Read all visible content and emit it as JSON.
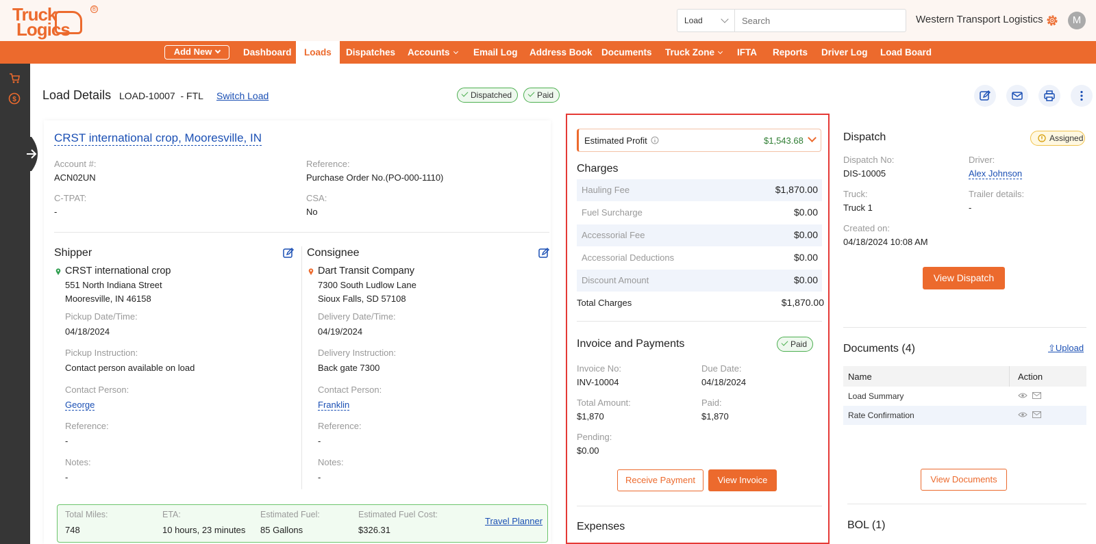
{
  "brand": {
    "logo_line1": "Truck",
    "logo_line2": "Logics",
    "accent": "#ec6a2d"
  },
  "header": {
    "search_scope": "Load",
    "search_placeholder": "Search",
    "company": "Western Transport Logistics",
    "avatar_initial": "M"
  },
  "nav": {
    "add_new": "Add New",
    "items": [
      "Dashboard",
      "Loads",
      "Dispatches",
      "Accounts",
      "Email Log",
      "Address Book",
      "Documents",
      "Truck Zone",
      "IFTA",
      "Reports",
      "Driver Log",
      "Load Board"
    ],
    "active": "Loads"
  },
  "page": {
    "title": "Load Details",
    "load_id": "LOAD-10007  - FTL",
    "switch_load": "Switch Load",
    "badges": [
      "Dispatched",
      "Paid"
    ]
  },
  "customer": {
    "name": "CRST international crop, Mooresville, IN",
    "account_label": "Account #:",
    "account": "ACN02UN",
    "reference_label": "Reference:",
    "reference": "Purchase Order No.(PO-000-1110)",
    "ctpat_label": "C-TPAT:",
    "ctpat": "-",
    "csa_label": "CSA:",
    "csa": "No"
  },
  "shipper": {
    "heading": "Shipper",
    "name": "CRST international crop",
    "address1": "551 North Indiana Street",
    "address2": "Mooresville, IN 46158",
    "date_label": "Pickup Date/Time:",
    "date": "04/18/2024",
    "instruction_label": "Pickup Instruction:",
    "instruction": "Contact person available on load",
    "contact_label": "Contact Person:",
    "contact": "George",
    "reference_label": "Reference:",
    "reference": "-",
    "notes_label": "Notes:",
    "notes": "-"
  },
  "consignee": {
    "heading": "Consignee",
    "name": "Dart Transit Company",
    "address1": "7300 South Ludlow Lane",
    "address2": "Sioux Falls, SD 57108",
    "date_label": "Delivery Date/Time:",
    "date": "04/19/2024",
    "instruction_label": "Delivery Instruction:",
    "instruction": "Back gate 7300",
    "contact_label": "Contact Person:",
    "contact": "Franklin",
    "reference_label": "Reference:",
    "reference": "-",
    "notes_label": "Notes:",
    "notes": "-"
  },
  "trip": {
    "miles_label": "Total Miles:",
    "miles": "748",
    "eta_label": "ETA:",
    "eta": "10 hours, 23 minutes",
    "fuel_label": "Estimated Fuel:",
    "fuel": "85 Gallons",
    "fuel_cost_label": "Estimated Fuel Cost:",
    "fuel_cost": "$326.31",
    "planner": "Travel Planner"
  },
  "finance": {
    "profit_label": "Estimated Profit",
    "profit": "$1,543.68",
    "charges_heading": "Charges",
    "charges": [
      {
        "label": "Hauling Fee",
        "value": "$1,870.00"
      },
      {
        "label": "Fuel Surcharge",
        "value": "$0.00"
      },
      {
        "label": "Accessorial Fee",
        "value": "$0.00"
      },
      {
        "label": "Accessorial Deductions",
        "value": "$0.00"
      },
      {
        "label": "Discount Amount",
        "value": "$0.00"
      }
    ],
    "total_label": "Total Charges",
    "total": "$1,870.00",
    "invoice_heading": "Invoice and Payments",
    "invoice_status": "Paid",
    "invoice_no_label": "Invoice No:",
    "invoice_no": "INV-10004",
    "due_label": "Due Date:",
    "due": "04/18/2024",
    "total_amount_label": "Total Amount:",
    "total_amount": "$1,870",
    "paid_label": "Paid:",
    "paid": "$1,870",
    "pending_label": "Pending:",
    "pending": "$0.00",
    "receive_payment": "Receive Payment",
    "view_invoice": "View Invoice",
    "expenses_heading": "Expenses"
  },
  "dispatch": {
    "heading": "Dispatch",
    "status": "Assigned",
    "no_label": "Dispatch No:",
    "no": "DIS-10005",
    "driver_label": "Driver:",
    "driver": "Alex Johnson",
    "truck_label": "Truck:",
    "truck": "Truck 1",
    "trailer_label": "Trailer details:",
    "trailer": "-",
    "created_label": "Created on:",
    "created": "04/18/2024 10:08 AM",
    "view_button": "View Dispatch"
  },
  "documents": {
    "heading": "Documents (4)",
    "upload": "Upload",
    "col_name": "Name",
    "col_action": "Action",
    "rows": [
      "Load Summary",
      "Rate Confirmation"
    ],
    "view_button": "View Documents"
  },
  "bol": {
    "heading": "BOL (1)"
  }
}
